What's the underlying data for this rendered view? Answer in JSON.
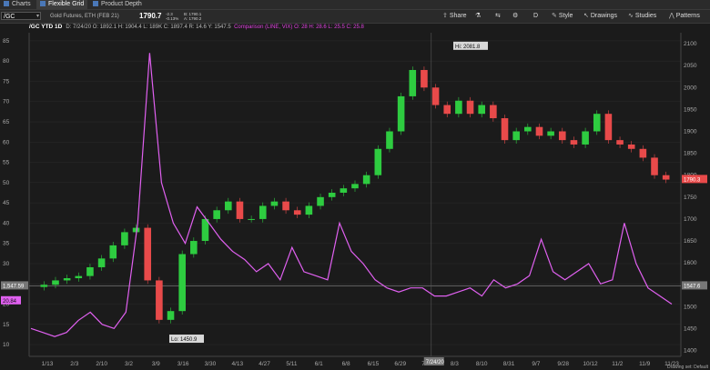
{
  "tabs": [
    {
      "label": "Charts"
    },
    {
      "label": "Flexible Grid"
    },
    {
      "label": "Product Depth"
    }
  ],
  "symbol": {
    "value": "/GC"
  },
  "instrument": {
    "description": "Gold Futures, ETH (FEB 21)",
    "last": "1790.7",
    "change1": "-2.3",
    "change2": "-0.13%",
    "bid": "B: 1790.1",
    "ask": "A: 1790.2"
  },
  "toolbar": {
    "share": "Share",
    "style": "Style",
    "drawings": "Drawings",
    "studies": "Studies",
    "patterns": "Patterns",
    "d_label": "D"
  },
  "study": {
    "title": "/GC YTD 1D",
    "ohlc": "D: 7/24/20  O: 1892.1  H: 1904.4  L: 189K  C: 1897.4  R: 14.6  Y: 1547.5",
    "comparison": "Comparison (LINE, VIX)  O: 28  H: 28.6  L: 25.5  C: 25.8"
  },
  "labels": {
    "hi": "Hi: 2081.8",
    "lo": "Lo: 1450.9",
    "price_tag": "1790.3",
    "vix_tag": "20.84",
    "ref_left": "1,547.59",
    "ref_right": "1547.6",
    "date_marker": "7/24/20",
    "drawing_set": "Drawing set: Default"
  },
  "left_axis": [
    "85",
    "80",
    "75",
    "70",
    "65",
    "60",
    "55",
    "50",
    "45",
    "40",
    "35",
    "30",
    "25",
    "20",
    "15",
    "10"
  ],
  "right_axis": [
    "2100",
    "2050",
    "2000",
    "1950",
    "1900",
    "1850",
    "1800",
    "1750",
    "1700",
    "1650",
    "1600",
    "1550",
    "1500",
    "1450",
    "1400"
  ],
  "x_axis": [
    "1/13",
    "2/3",
    "2/10",
    "3/2",
    "3/9",
    "3/16",
    "3/30",
    "4/13",
    "4/27",
    "5/11",
    "6/1",
    "6/8",
    "6/15",
    "6/29",
    "7/13",
    "8/3",
    "8/10",
    "8/31",
    "9/7",
    "9/28",
    "10/12",
    "11/2",
    "11/9",
    "11/23"
  ],
  "chart_data": {
    "type": "line",
    "series": [
      {
        "name": "/GC",
        "kind": "candlestick",
        "close": [
          1550,
          1560,
          1565,
          1570,
          1590,
          1610,
          1640,
          1670,
          1680,
          1560,
          1470,
          1490,
          1620,
          1650,
          1700,
          1720,
          1740,
          1700,
          1700,
          1730,
          1740,
          1720,
          1710,
          1730,
          1750,
          1760,
          1770,
          1780,
          1800,
          1860,
          1900,
          1980,
          2040,
          2000,
          1960,
          1940,
          1970,
          1940,
          1960,
          1930,
          1880,
          1900,
          1910,
          1890,
          1900,
          1880,
          1870,
          1900,
          1940,
          1880,
          1870,
          1860,
          1840,
          1800,
          1790
        ]
      },
      {
        "name": "VIX",
        "kind": "line",
        "values": [
          14,
          13,
          12,
          13,
          16,
          18,
          15,
          14,
          18,
          40,
          82,
          50,
          40,
          35,
          44,
          40,
          36,
          33,
          31,
          28,
          30,
          26,
          34,
          28,
          27,
          26,
          40,
          33,
          30,
          26,
          24,
          23,
          24,
          24,
          22,
          22,
          23,
          24,
          22,
          26,
          24,
          25,
          27,
          36,
          28,
          26,
          28,
          30,
          25,
          26,
          40,
          30,
          24,
          22,
          20
        ]
      }
    ],
    "x_ticks": [
      "1/13",
      "2/3",
      "2/10",
      "3/2",
      "3/9",
      "3/16",
      "3/30",
      "4/13",
      "4/27",
      "5/11",
      "6/1",
      "6/8",
      "6/15",
      "6/29",
      "7/13",
      "8/3",
      "8/10",
      "8/31",
      "9/7",
      "9/28",
      "10/12",
      "11/2",
      "11/9",
      "11/23"
    ],
    "vix_range": [
      8,
      87
    ],
    "gc_range": [
      1395,
      2125
    ],
    "colors": {
      "up": "#2ecc40",
      "down": "#e84a4a",
      "vix": "#e060f0",
      "grid": "#2c2c2c"
    }
  }
}
